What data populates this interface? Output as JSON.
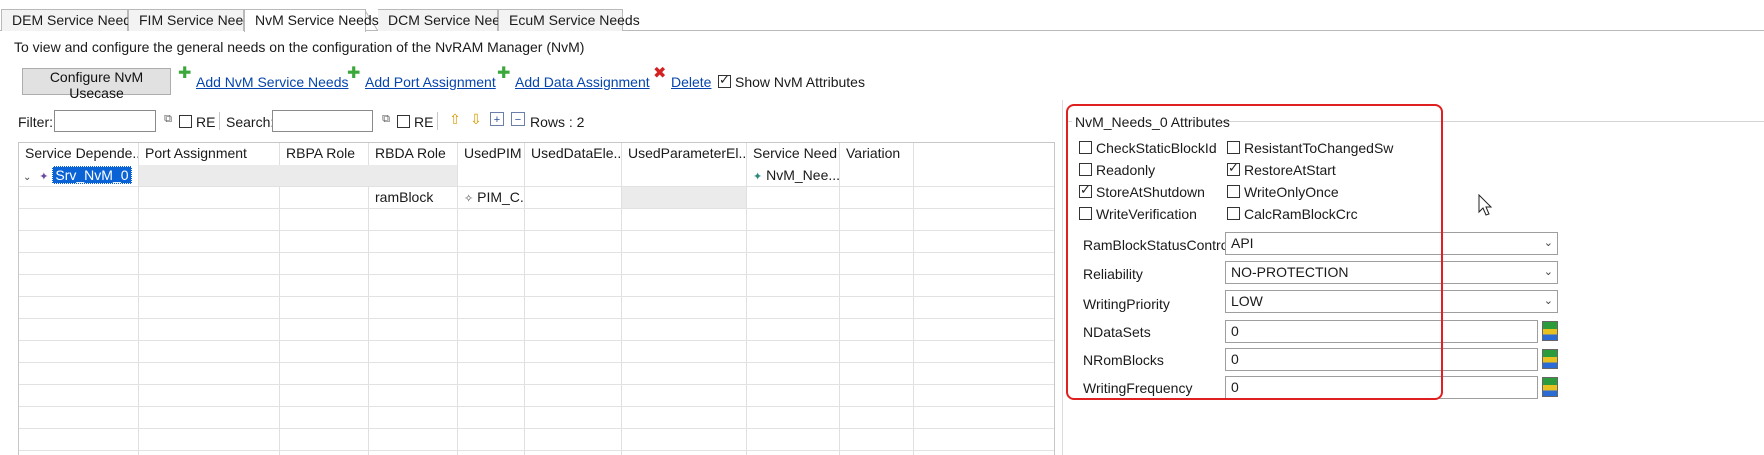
{
  "tabs": [
    {
      "label": "DEM Service Needs"
    },
    {
      "label": "FIM Service Needs"
    },
    {
      "label": "NvM Service Needs"
    },
    {
      "label": "DCM Service Needs"
    },
    {
      "label": "EcuM Service Needs"
    }
  ],
  "description": "To view and configure the general needs on the configuration of the  NvRAM Manager (NvM)",
  "toolbar": {
    "configure_label": "Configure NvM Usecase",
    "add_service_needs": "Add NvM Service Needs",
    "add_port_assignment": "Add Port Assignment",
    "add_data_assignment": "Add Data Assignment",
    "delete": "Delete",
    "show_attributes": "Show NvM Attributes",
    "show_attributes_checked": true
  },
  "filterbar": {
    "filter_label": "Filter:",
    "filter_value": "",
    "re_label_1": "RE",
    "search_label": "Search:",
    "search_value": "",
    "re_label_2": "RE",
    "rows_label": "Rows : 2"
  },
  "table": {
    "columns": [
      "Service Depende...",
      "Port Assignment",
      "RBPA Role",
      "RBDA Role",
      "UsedPIM",
      "UsedDataEle...",
      "UsedParameterEl...",
      "Service Need",
      "Variation"
    ],
    "rows": [
      {
        "service_dependency": "Srv_NvM_0",
        "service_need": "NvM_Nee..."
      },
      {
        "rbda_role": "ramBlock",
        "used_pim": "PIM_C..."
      }
    ]
  },
  "attributes": {
    "title": "NvM_Needs_0 Attributes",
    "checkboxes": [
      {
        "label": "CheckStaticBlockId",
        "checked": false
      },
      {
        "label": "ResistantToChangedSw",
        "checked": false
      },
      {
        "label": "Readonly",
        "checked": false
      },
      {
        "label": "RestoreAtStart",
        "checked": true
      },
      {
        "label": "StoreAtShutdown",
        "checked": true
      },
      {
        "label": "WriteOnlyOnce",
        "checked": false
      },
      {
        "label": "WriteVerification",
        "checked": false
      },
      {
        "label": "CalcRamBlockCrc",
        "checked": false
      }
    ],
    "fields": [
      {
        "label": "RamBlockStatusControl",
        "value": "API"
      },
      {
        "label": "Reliability",
        "value": "NO-PROTECTION"
      },
      {
        "label": "WritingPriority",
        "value": "LOW"
      },
      {
        "label": "NDataSets",
        "value": "0"
      },
      {
        "label": "NRomBlocks",
        "value": "0"
      },
      {
        "label": "WritingFrequency",
        "value": "0"
      }
    ]
  }
}
